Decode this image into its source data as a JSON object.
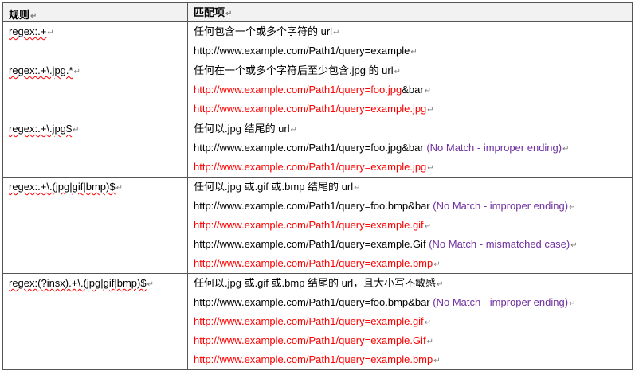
{
  "header": {
    "rule": "规则",
    "match": "匹配项"
  },
  "rows": [
    {
      "rule": "regex:.+",
      "lines": [
        {
          "text": "任何包含一个或多个字符的 url",
          "note": "",
          "kind": "desc"
        },
        {
          "text": "http://www.example.com/Path1/query=example",
          "note": "",
          "kind": "match"
        }
      ]
    },
    {
      "rule": "regex:.+\\.jpg.*",
      "lines": [
        {
          "text": "任何在一个或多个字符后至少包含.jpg 的 url",
          "note": "",
          "kind": "desc"
        },
        {
          "text": "http://www.example.com/Path1/query=foo.jpg",
          "suffix": "&bar",
          "note": "",
          "kind": "red"
        },
        {
          "text": "http://www.example.com/Path1/query=example.jpg",
          "note": "",
          "kind": "red"
        }
      ]
    },
    {
      "rule": "regex:.+\\.jpg$",
      "lines": [
        {
          "text": "任何以.jpg 结尾的 url",
          "note": "",
          "kind": "desc"
        },
        {
          "text": "http://www.example.com/Path1/query=foo.jpg&bar",
          "note": "(No Match - improper ending)",
          "kind": "nomatch"
        },
        {
          "text": "http://www.example.com/Path1/query=example.jpg",
          "note": "",
          "kind": "red"
        }
      ]
    },
    {
      "rule": "regex:.+\\.(jpg|gif|bmp)$",
      "lines": [
        {
          "text": "任何以.jpg 或.gif 或.bmp 结尾的 url",
          "note": "",
          "kind": "desc"
        },
        {
          "text": "http://www.example.com/Path1/query=foo.bmp&bar",
          "note": "(No Match   - improper ending)",
          "kind": "nomatch"
        },
        {
          "text": "http://www.example.com/Path1/query=example.gif",
          "note": "",
          "kind": "red"
        },
        {
          "text": "http://www.example.com/Path1/query=example.Gif",
          "note": "(No Match - mismatched case)",
          "kind": "nomatch"
        },
        {
          "text": "http://www.example.com/Path1/query=example.bmp",
          "note": "",
          "kind": "red"
        }
      ]
    },
    {
      "rule": "regex:(?insx).+\\.(jpg|gif|bmp)$",
      "lines": [
        {
          "text": "任何以.jpg 或.gif 或.bmp 结尾的 url，且大小写不敏感",
          "note": "",
          "kind": "desc"
        },
        {
          "text": "http://www.example.com/Path1/query=foo.bmp&bar",
          "note": "(No Match - improper ending)",
          "kind": "nomatch"
        },
        {
          "text": "http://www.example.com/Path1/query=example.gif",
          "note": "",
          "kind": "red"
        },
        {
          "text": "http://www.example.com/Path1/query=example.Gif",
          "note": "",
          "kind": "red"
        },
        {
          "text": "http://www.example.com/Path1/query=example.bmp",
          "note": "",
          "kind": "red"
        }
      ]
    }
  ],
  "colors": {
    "match": "#ff0000",
    "note": "#7030a0",
    "border": "#555555",
    "header_bg": "#f2f2f2"
  }
}
